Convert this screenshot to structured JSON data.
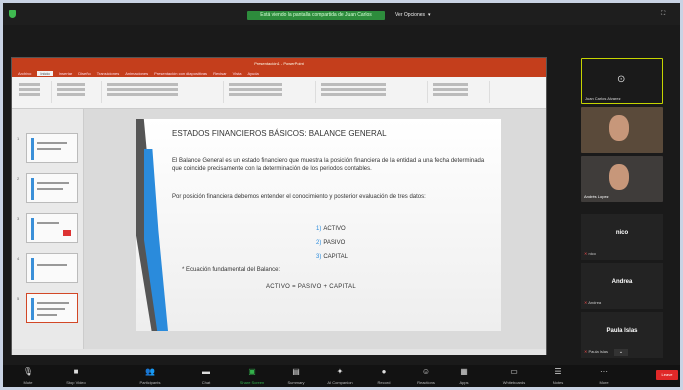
{
  "topbar": {
    "sharing_label": "Está viendo la pantalla compartida de Juan Carlos",
    "view_options_label": "Ver Opciones"
  },
  "ppt": {
    "window_title": "Presentación1 - PowerPoint",
    "menu_tabs": [
      "Archivo",
      "Inicio",
      "Insertar",
      "Diseño",
      "Transiciones",
      "Animaciones",
      "Presentación con diapositivas",
      "Revisar",
      "Vista",
      "Ayuda"
    ],
    "active_tab_index": 1
  },
  "slide": {
    "title": "ESTADOS FINANCIEROS BÁSICOS: BALANCE GENERAL",
    "paragraph1": "El Balance General es un estado financiero que muestra la posición financiera de la entidad a una fecha determinada que coincide precisamente con la determinación de los periodos contables.",
    "paragraph2": "Por posición financiera debemos entender el conocimiento y posterior evaluación de tres datos:",
    "list": [
      {
        "num": "1)",
        "text": "ACTIVO"
      },
      {
        "num": "2)",
        "text": "PASIVO"
      },
      {
        "num": "3)",
        "text": "CAPITAL"
      }
    ],
    "equation_label": "Ecuación fundamental del Balance:",
    "formula": "ACTIVO  =  PASIVO  +  CAPITAL"
  },
  "thumbnails": {
    "numbers": [
      "1",
      "2",
      "3",
      "4",
      "5"
    ],
    "selected_index": 4
  },
  "participants": {
    "video_tiles": [
      {
        "name": "Juan Carlos Alvarez",
        "selected": true
      },
      {
        "name": "",
        "selected": false
      },
      {
        "name": "Andrés Lopez",
        "selected": false
      }
    ],
    "name_tiles": [
      {
        "name": "nico",
        "mic_label": "nico"
      },
      {
        "name": "Andrea",
        "mic_label": "Andrea"
      },
      {
        "name": "Paula Islas",
        "mic_label": "Paula Islas"
      }
    ]
  },
  "toolbar": {
    "items": [
      {
        "label": "Mute",
        "icon": "microphone-icon"
      },
      {
        "label": "Stop Video",
        "icon": "video-icon"
      },
      {
        "label": "Participants",
        "icon": "participants-icon"
      },
      {
        "label": "Chat",
        "icon": "chat-icon"
      },
      {
        "label": "Share Screen",
        "icon": "share-screen-icon"
      },
      {
        "label": "Summary",
        "icon": "summary-icon"
      },
      {
        "label": "AI Companion",
        "icon": "ai-icon"
      },
      {
        "label": "Record",
        "icon": "record-icon"
      },
      {
        "label": "Reactions",
        "icon": "reactions-icon"
      },
      {
        "label": "Apps",
        "icon": "apps-icon"
      },
      {
        "label": "Whiteboards",
        "icon": "whiteboard-icon"
      },
      {
        "label": "Notes",
        "icon": "notes-icon"
      },
      {
        "label": "More",
        "icon": "more-icon"
      }
    ],
    "end_label": "Leave"
  },
  "colors": {
    "share_green": "#2d8c3c",
    "ppt_red": "#c43e1c",
    "selected_border": "#c6d400",
    "end_red": "#e02828",
    "slide_blue": "#2a8bdc"
  }
}
